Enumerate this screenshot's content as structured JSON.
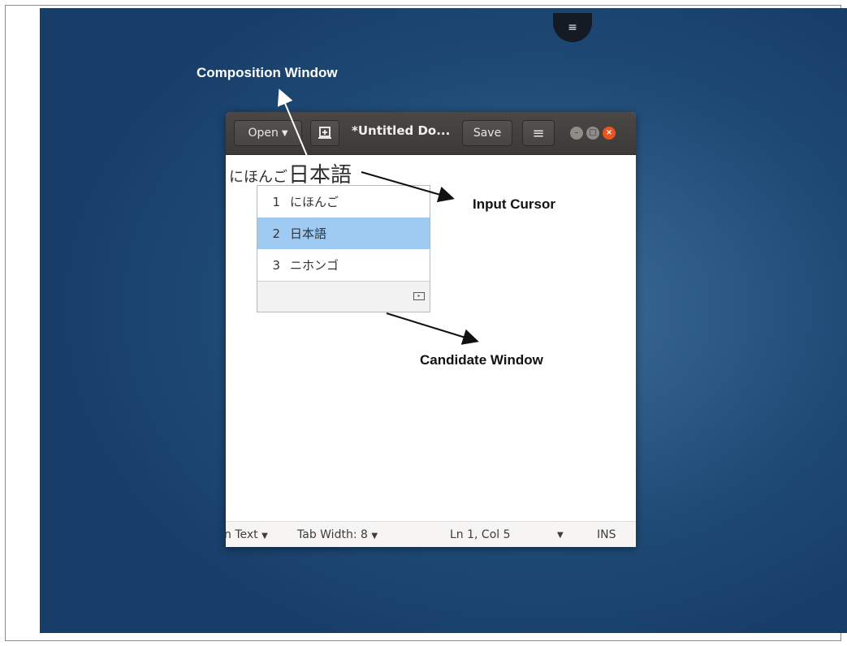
{
  "annotations": {
    "composition": "Composition Window",
    "input_cursor": "Input Cursor",
    "candidate": "Candidate Window"
  },
  "dock": {
    "icon": "hamburger-menu-icon",
    "glyph": "≡"
  },
  "editor_window": {
    "open_label": "Open",
    "new_tab_icon": "new-document-icon",
    "title": "*Untitled Do...",
    "save_label": "Save",
    "menu_glyph": "≡",
    "controls": {
      "minimize": "–",
      "maximize": "□",
      "close": "×"
    }
  },
  "preedit": {
    "kana": "にほんご",
    "kanji": "日本語"
  },
  "candidates": [
    {
      "num": "1",
      "text": "にほんご",
      "selected": false
    },
    {
      "num": "2",
      "text": "日本語",
      "selected": true
    },
    {
      "num": "3",
      "text": "ニホンゴ",
      "selected": false
    }
  ],
  "statusbar": {
    "language": "n Text",
    "tab_width": "Tab Width: 8",
    "position": "Ln 1, Col 5",
    "mode": "INS"
  },
  "colors": {
    "selection": "#9fcbf2",
    "close_button": "#e95420",
    "desktop": "#2d5a87"
  }
}
